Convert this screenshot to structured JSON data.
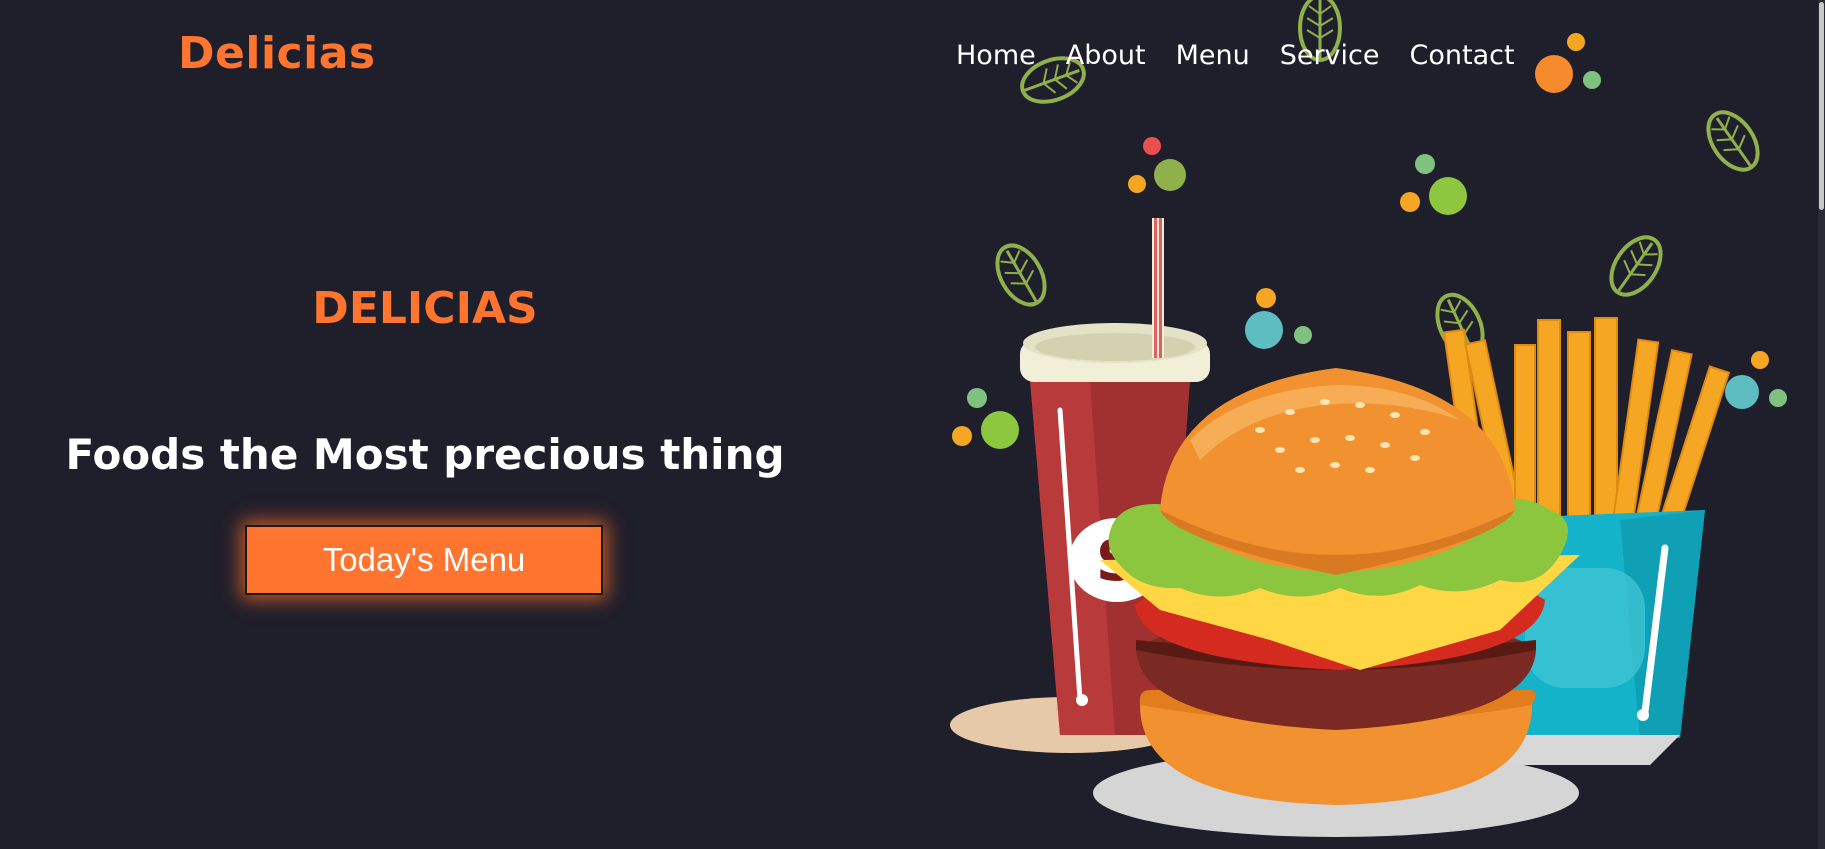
{
  "header": {
    "brand": "Delicias",
    "nav": [
      "Home",
      "About",
      "Menu",
      "Service",
      "Contact"
    ]
  },
  "hero": {
    "eyebrow": "DELICIAS",
    "title": "Foods the Most precious thing",
    "button_label": "Today's Menu"
  },
  "illustration": {
    "name": "burger-fries-drink-illustration",
    "cup_label": "S"
  },
  "colors": {
    "background": "#1f1e2b",
    "accent": "#ff7530",
    "text": "#ffffff"
  }
}
